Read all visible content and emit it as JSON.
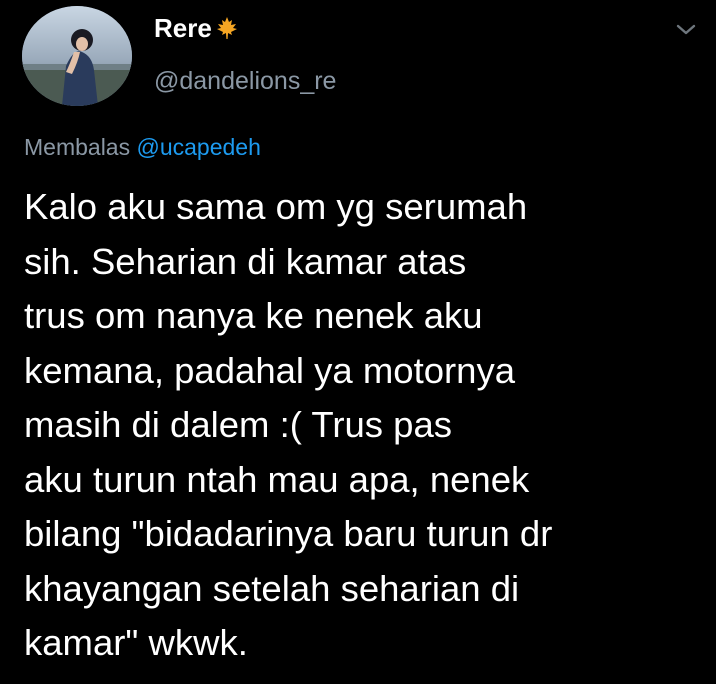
{
  "author": {
    "display_name": "Rere",
    "handle": "@dandelions_re",
    "badge_icon": "maple-leaf-icon",
    "badge_color": "#f6a623"
  },
  "menu": {
    "icon": "chevron-down-icon"
  },
  "reply": {
    "prefix": "Membalas",
    "mention": "@ucapedeh",
    "mention_color": "#1d9bf0"
  },
  "tweet": {
    "lines": [
      "Kalo aku sama om yg serumah",
      "sih. Seharian di kamar atas",
      "trus om nanya ke nenek aku",
      "kemana, padahal ya motornya",
      "masih di dalem :( Trus pas",
      "aku turun ntah mau apa, nenek",
      "bilang \"bidadarinya baru turun dr",
      "khayangan setelah seharian di",
      "kamar\" wkwk."
    ]
  }
}
